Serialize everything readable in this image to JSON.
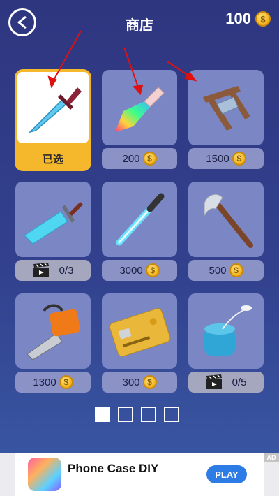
{
  "header": {
    "title": "商店",
    "coins": "100",
    "coin_symbol": "$"
  },
  "items": [
    {
      "name": "knife",
      "label": "已选",
      "selected": true
    },
    {
      "name": "rainbow-knife",
      "price": "200"
    },
    {
      "name": "guillotine",
      "price": "1500"
    },
    {
      "name": "buster-sword",
      "video_progress": "0/3"
    },
    {
      "name": "lightsaber",
      "price": "3000"
    },
    {
      "name": "axe",
      "price": "500"
    },
    {
      "name": "chainsaw",
      "price": "1300"
    },
    {
      "name": "credit-card",
      "price": "300"
    },
    {
      "name": "floss-box",
      "video_progress": "0/5"
    }
  ],
  "pager": {
    "pages": 4,
    "active": 1
  },
  "ad": {
    "title": "Phone Case DIY",
    "play": "PLAY",
    "badge": "AD"
  },
  "colors": {
    "accent": "#f5b82c",
    "card": "#7b86c5",
    "bg": "#2f3680"
  }
}
